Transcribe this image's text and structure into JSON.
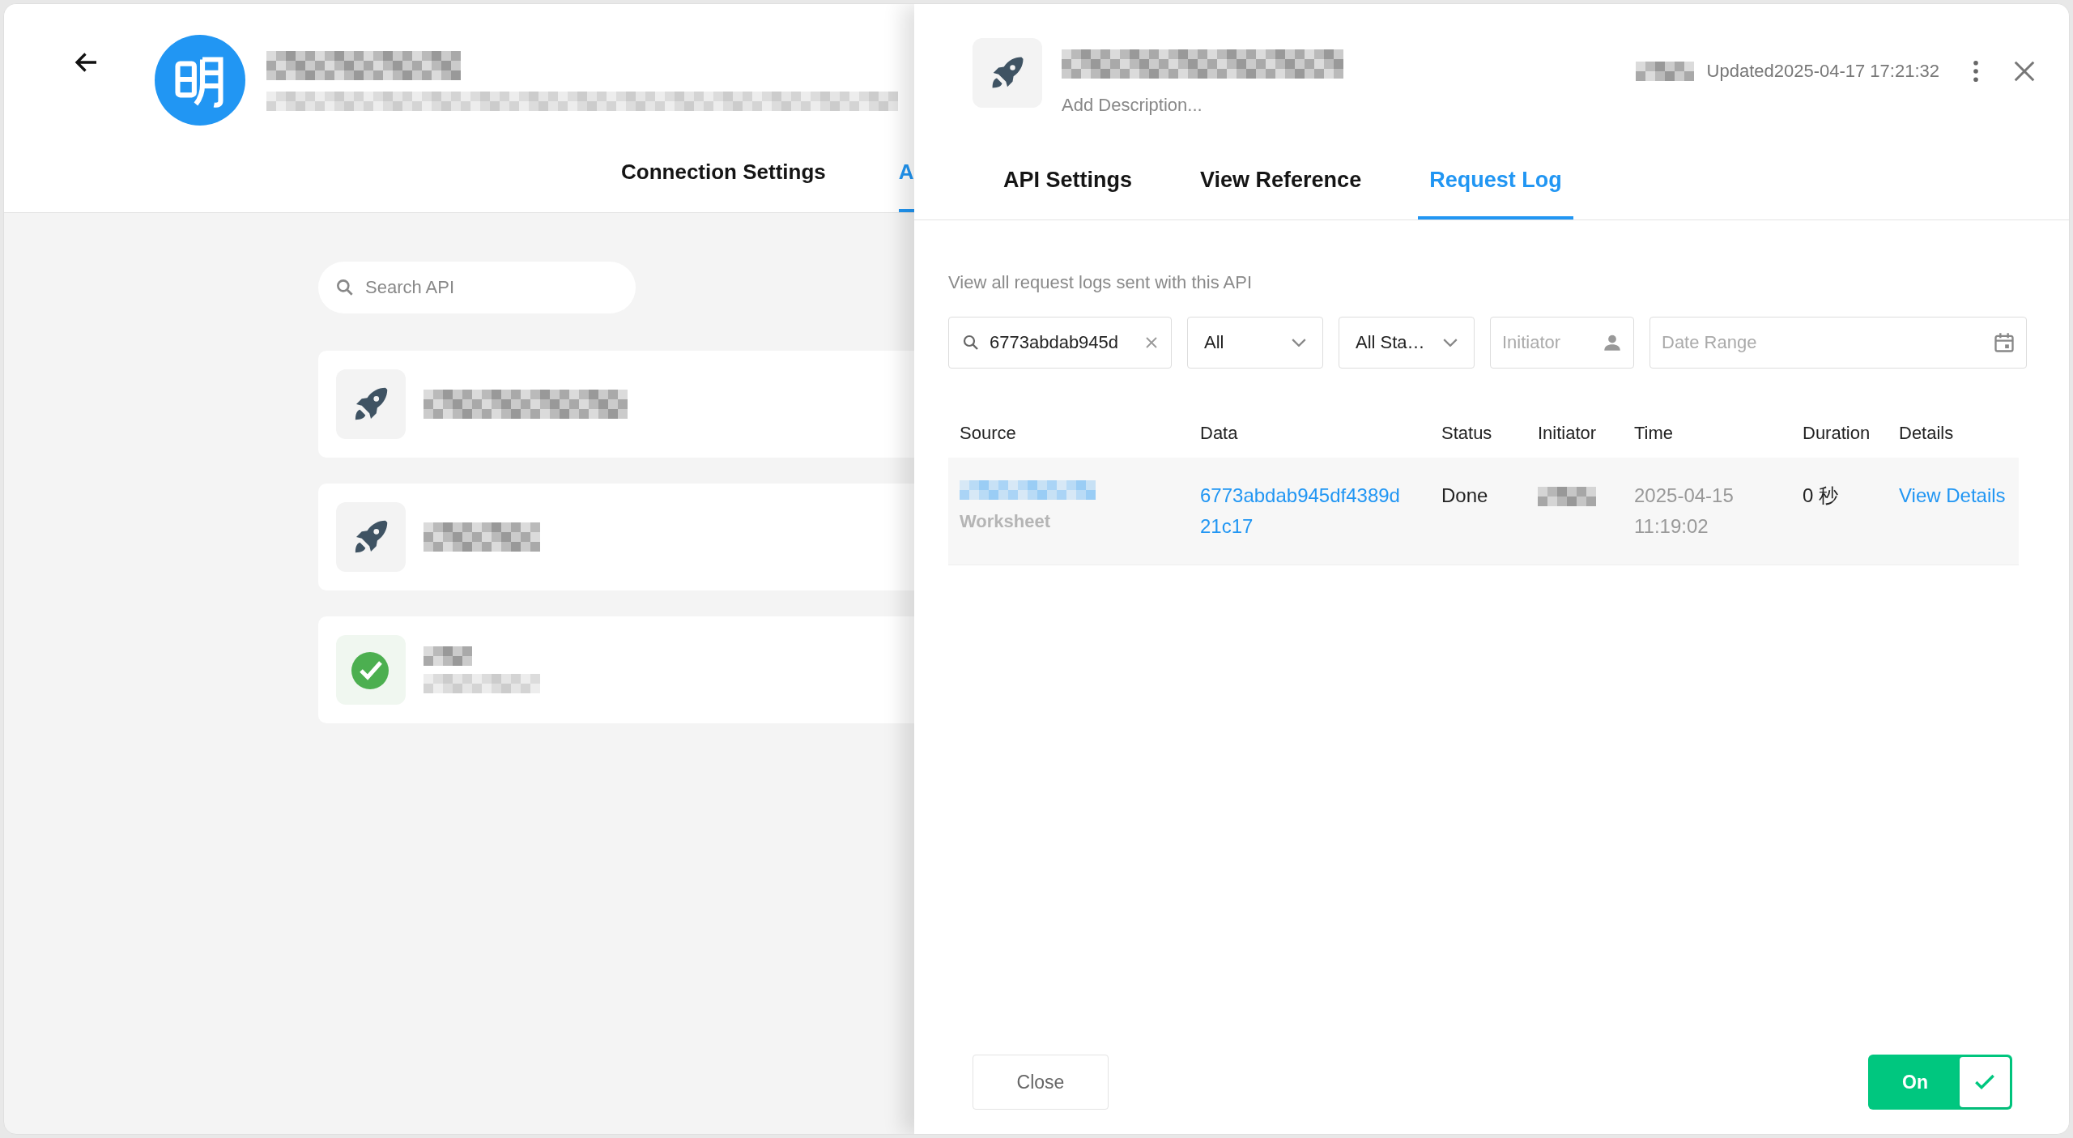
{
  "page": {
    "tabs": [
      {
        "label": "Connection Settings",
        "selected": false
      },
      {
        "label": "A",
        "selected": true
      }
    ],
    "search": {
      "placeholder": "Search API"
    },
    "api_list": [
      {
        "kind": "rocket"
      },
      {
        "kind": "rocket"
      },
      {
        "kind": "done"
      }
    ]
  },
  "drawer": {
    "description": {
      "placeholder": "Add Description..."
    },
    "updated": "Updated2025-04-17 17:21:32",
    "tabs": [
      {
        "label": "API Settings",
        "selected": false
      },
      {
        "label": "View Reference",
        "selected": false
      },
      {
        "label": "Request Log",
        "selected": true
      }
    ],
    "intro": "View all request logs sent with this API",
    "filters": {
      "search": {
        "value": "6773abdab945d"
      },
      "type": {
        "value": "All"
      },
      "status": {
        "value": "All Sta…"
      },
      "initiator": {
        "placeholder": "Initiator"
      },
      "date": {
        "placeholder": "Date Range"
      }
    },
    "table": {
      "columns": [
        "Source",
        "Data",
        "Status",
        "Initiator",
        "Time",
        "Duration",
        "Details"
      ],
      "rows": [
        {
          "source_type": "Worksheet",
          "data": "6773abdab945df4389d21c17",
          "status": "Done",
          "time": "2025-04-15 11:19:02",
          "duration": "0 秒",
          "details": "View Details"
        }
      ]
    },
    "footer": {
      "close": "Close",
      "toggle": {
        "label": "On",
        "on": true
      }
    }
  }
}
